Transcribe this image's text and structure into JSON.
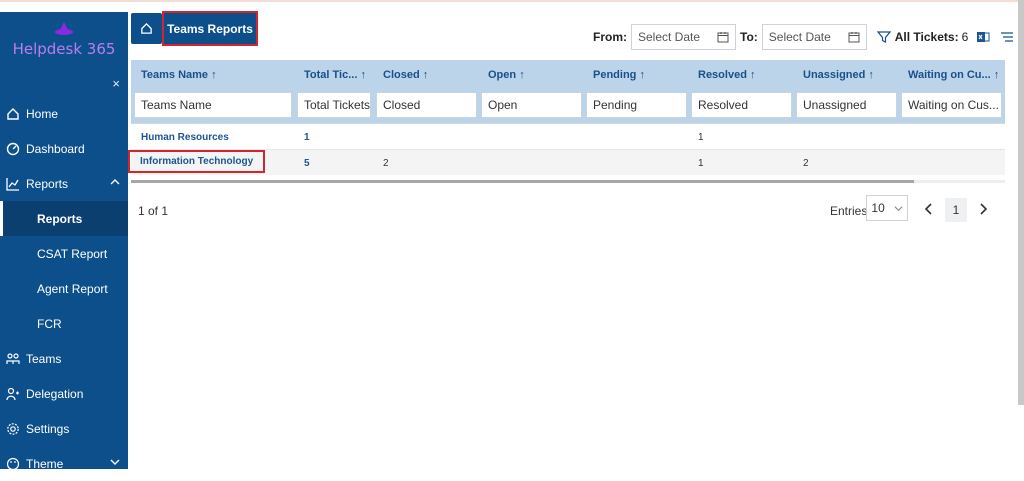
{
  "app": {
    "name": "Helpdesk 365",
    "brand_color": "#0d4f8b",
    "accent_color": "#b77ef2",
    "highlight_color": "#d0262d"
  },
  "sidebar": {
    "close": "×",
    "items": [
      {
        "label": "Home",
        "icon": "home-icon"
      },
      {
        "label": "Dashboard",
        "icon": "dashboard-icon"
      },
      {
        "label": "Reports",
        "icon": "chart-line-icon",
        "expanded": true
      },
      {
        "label": "Reports",
        "sub": true,
        "active": true
      },
      {
        "label": "CSAT Report",
        "sub": true
      },
      {
        "label": "Agent Report",
        "sub": true
      },
      {
        "label": "FCR",
        "sub": true
      },
      {
        "label": "Teams",
        "icon": "teams-icon"
      },
      {
        "label": "Delegation",
        "icon": "delegation-icon"
      },
      {
        "label": "Settings",
        "icon": "gear-icon"
      },
      {
        "label": "Theme",
        "icon": "palette-icon"
      }
    ]
  },
  "breadcrumb": {
    "tab": "Teams Reports"
  },
  "filters": {
    "from_label": "From:",
    "from_placeholder": "Select Date",
    "to_label": "To:",
    "to_placeholder": "Select Date",
    "all_tickets_label": "All Tickets:",
    "all_tickets_count": "6"
  },
  "table": {
    "columns": [
      {
        "label": "Teams Name",
        "filter": "Teams Name"
      },
      {
        "label": "Total Tic...",
        "filter": "Total Tickets"
      },
      {
        "label": "Closed",
        "filter": "Closed"
      },
      {
        "label": "Open",
        "filter": "Open"
      },
      {
        "label": "Pending",
        "filter": "Pending"
      },
      {
        "label": "Resolved",
        "filter": "Resolved"
      },
      {
        "label": "Unassigned",
        "filter": "Unassigned"
      },
      {
        "label": "Waiting on Cu...",
        "filter": "Waiting on Cus..."
      }
    ],
    "sort_arrow": "↑",
    "rows": [
      {
        "team": "Human Resources",
        "total": "1",
        "closed": "",
        "open": "",
        "pending": "",
        "resolved": "1",
        "unassigned": "",
        "waiting": ""
      },
      {
        "team": "Information Technology",
        "total": "5",
        "closed": "2",
        "open": "",
        "pending": "",
        "resolved": "1",
        "unassigned": "2",
        "waiting": ""
      }
    ]
  },
  "pager": {
    "summary": "1 of 1",
    "entries_label": "Entries",
    "entries_value": "10",
    "page": "1"
  }
}
